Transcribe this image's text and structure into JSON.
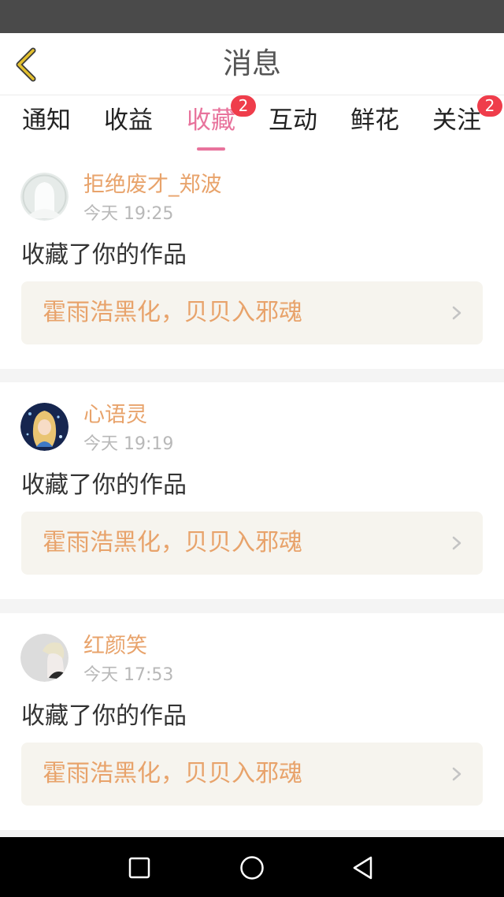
{
  "header": {
    "title": "消息"
  },
  "tabs": [
    {
      "label": "通知"
    },
    {
      "label": "收益"
    },
    {
      "label": "收藏",
      "badge": "2",
      "active": true
    },
    {
      "label": "互动"
    },
    {
      "label": "鲜花"
    },
    {
      "label": "关注",
      "badge": "2"
    }
  ],
  "messages": [
    {
      "user": "拒绝废才_郑波",
      "time": "今天 19:25",
      "action": "收藏了你的作品",
      "work": "霍雨浩黑化，贝贝入邪魂",
      "avatar": "default-avatar"
    },
    {
      "user": "心语灵",
      "time": "今天 19:19",
      "action": "收藏了你的作品",
      "work": "霍雨浩黑化，贝贝入邪魂",
      "avatar": "anime-girl-avatar"
    },
    {
      "user": "红颜笑",
      "time": "今天 17:53",
      "action": "收藏了你的作品",
      "work": "霍雨浩黑化，贝贝入邪魂",
      "avatar": "anime-man-avatar"
    }
  ],
  "colors": {
    "accent_pink": "#e8739c",
    "accent_orange": "#e8a36b",
    "badge_red": "#ef3d4b",
    "back_yellow": "#e3c02e"
  }
}
